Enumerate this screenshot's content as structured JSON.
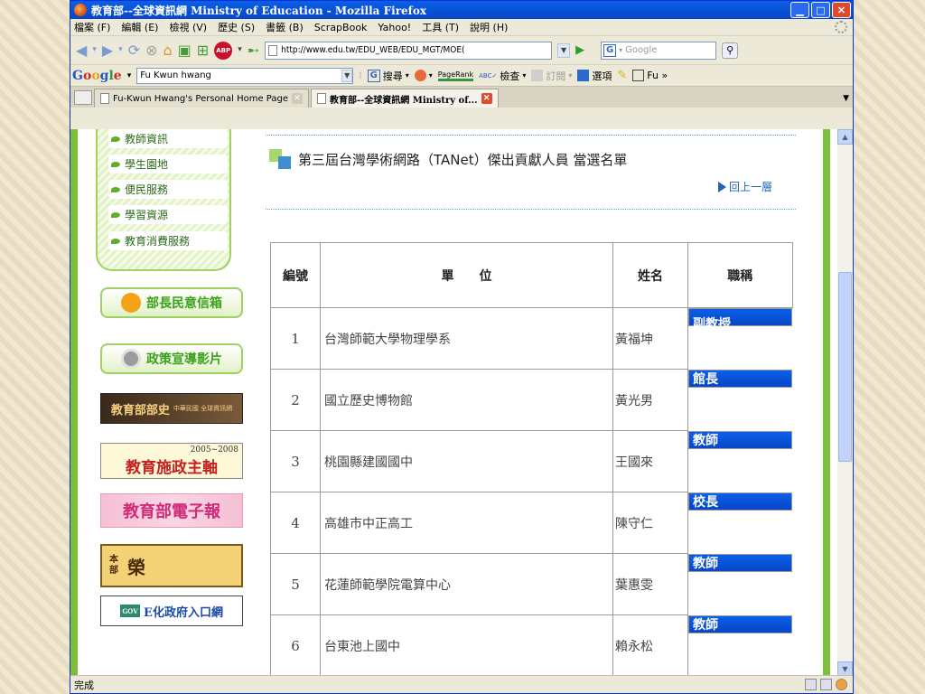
{
  "window": {
    "title": "教育部--全球資訊網 Ministry of Education - Mozilla Firefox"
  },
  "menu": [
    "檔案 (F)",
    "編輯 (E)",
    "檢視 (V)",
    "歷史 (S)",
    "書籤 (B)",
    "ScrapBook",
    "Yahoo!",
    "工具 (T)",
    "說明 (H)"
  ],
  "nav": {
    "url": "http://www.edu.tw/EDU_WEB/EDU_MGT/MOE(",
    "search_placeholder": "Google"
  },
  "gtoolbar": {
    "search_value": "Fu Kwun hwang",
    "search_label": "搜尋",
    "pagerank": "PageRank",
    "check": "檢查",
    "subscribe": "訂閱",
    "options": "選項",
    "user": "Fu »"
  },
  "tabs": [
    {
      "label": "Fu-Kwun Hwang's Personal Home Page"
    },
    {
      "label": "教育部--全球資訊網 Ministry of..."
    }
  ],
  "sidebar": {
    "items": [
      "教師資訊",
      "學生園地",
      "便民服務",
      "學習資源",
      "教育消費服務"
    ],
    "banners": {
      "mailbox": "部長民意信箱",
      "video": "政策宣導影片",
      "history": "教育部部史",
      "history_small": "中華民國 全球資訊網",
      "policy": "教育施政主軸",
      "policy_years": "2005~2008",
      "epaper": "教育部電子報",
      "honor_small": "本部",
      "honor": "榮",
      "egov": "E化政府入口網",
      "egov_small": "GOV"
    }
  },
  "main": {
    "heading": "第三屆台灣學術網路（TANet）傑出貢獻人員 當選名單",
    "back_link": "回上一層",
    "table": {
      "headers": [
        "編號",
        "單　　位",
        "姓名",
        "職稱"
      ],
      "rows": [
        {
          "no": "1",
          "unit": "台灣師範大學物理學系",
          "name": "黃福坤",
          "title": "副教授"
        },
        {
          "no": "2",
          "unit": "國立歷史博物館",
          "name": "黃光男",
          "title": "館長"
        },
        {
          "no": "3",
          "unit": "桃園縣建國國中",
          "name": "王國來",
          "title": "教師"
        },
        {
          "no": "4",
          "unit": "高雄市中正高工",
          "name": "陳守仁",
          "title": "校長"
        },
        {
          "no": "5",
          "unit": "花蓮師範學院電算中心",
          "name": "葉惠雯",
          "title": "教師"
        },
        {
          "no": "6",
          "unit": "台東池上國中",
          "name": "賴永松",
          "title": "教師"
        }
      ]
    }
  },
  "status": {
    "text": "完成"
  }
}
